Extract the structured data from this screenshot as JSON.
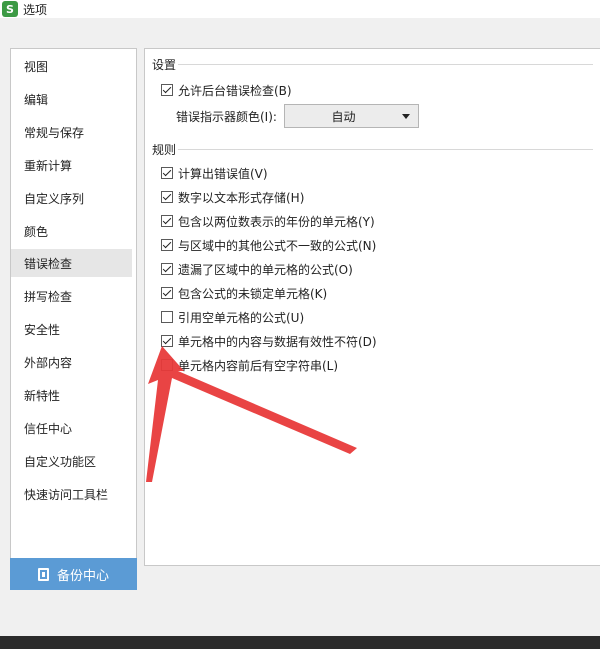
{
  "window": {
    "title": "选项",
    "app_icon_letter": "S"
  },
  "sidebar": {
    "items": [
      {
        "label": "视图"
      },
      {
        "label": "编辑"
      },
      {
        "label": "常规与保存"
      },
      {
        "label": "重新计算"
      },
      {
        "label": "自定义序列"
      },
      {
        "label": "颜色"
      },
      {
        "label": "错误检查"
      },
      {
        "label": "拼写检查"
      },
      {
        "label": "安全性"
      },
      {
        "label": "外部内容"
      },
      {
        "label": "新特性"
      },
      {
        "label": "信任中心"
      },
      {
        "label": "自定义功能区"
      },
      {
        "label": "快速访问工具栏"
      }
    ],
    "active_index": 6,
    "backup_button": "备份中心"
  },
  "settings": {
    "section_title": "设置",
    "allow_background": {
      "label": "允许后台错误检查(B)",
      "checked": true
    },
    "indicator_color_label": "错误指示器颜色(I):",
    "indicator_color_value": "自动"
  },
  "rules": {
    "section_title": "规则",
    "items": [
      {
        "label": "计算出错误值(V)",
        "checked": true
      },
      {
        "label": "数字以文本形式存储(H)",
        "checked": true
      },
      {
        "label": "包含以两位数表示的年份的单元格(Y)",
        "checked": true
      },
      {
        "label": "与区域中的其他公式不一致的公式(N)",
        "checked": true
      },
      {
        "label": "遗漏了区域中的单元格的公式(O)",
        "checked": true
      },
      {
        "label": "包含公式的未锁定单元格(K)",
        "checked": true
      },
      {
        "label": "引用空单元格的公式(U)",
        "checked": false
      },
      {
        "label": "单元格中的内容与数据有效性不符(D)",
        "checked": true
      },
      {
        "label": "单元格内容前后有空字符串(L)",
        "checked": false
      }
    ]
  },
  "colors": {
    "accent": "#5b9bd5",
    "annotation_arrow": "#e83a3a",
    "app_icon": "#3c9a44"
  }
}
